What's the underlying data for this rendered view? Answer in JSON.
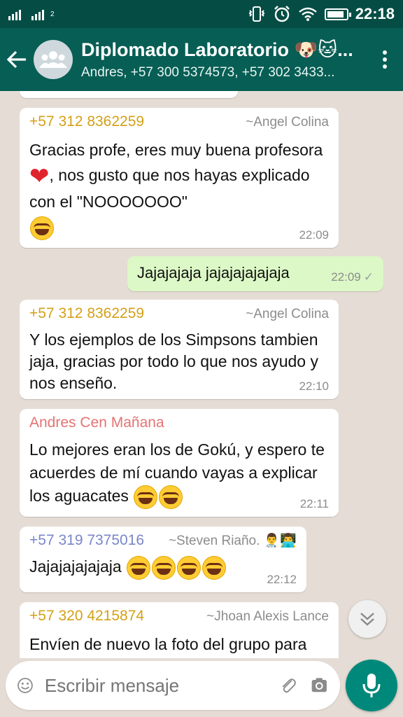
{
  "status_bar": {
    "signal1_label": "",
    "signal2_label": "2",
    "time": "22:18",
    "battery_level": 0.9
  },
  "header": {
    "title": "Diplomado Laboratorio 🐶🐱...",
    "subtitle": "Andres, +57 300 5374573, +57 302 3433..."
  },
  "messages": [
    {
      "sender": "+57 312 8362259",
      "sender_color": "#d4a017",
      "pushname": "~Angel Colina",
      "text_a": "Gracias profe, eres muy buena profesora ",
      "text_b": ", nos gusto que nos hayas explicado con el \"NOOOOOOO\"",
      "time": "22:09"
    },
    {
      "text": "Jajajajaja jajajajajajaja",
      "time": "22:09",
      "outgoing": true
    },
    {
      "sender": "+57 312 8362259",
      "sender_color": "#d4a017",
      "pushname": "~Angel Colina",
      "text": "Y los ejemplos de los Simpsons tambien jaja, gracias por todo lo que nos ayudo y nos enseño.",
      "time": "22:10"
    },
    {
      "sender": "Andres Cen Mañana",
      "sender_color": "#e57373",
      "text": "Lo mejores eran los de Gokú, y espero te acuerdes de mí cuando vayas a explicar los aguacates ",
      "time": "22:11"
    },
    {
      "sender": "+57 319 7375016",
      "sender_color": "#7986cb",
      "pushname": "~Steven Riaño. 👨‍⚕️👨‍💻",
      "text": "Jajajajajajaja ",
      "time": "22:12"
    },
    {
      "sender": "+57 320 4215874",
      "sender_color": "#d4a017",
      "pushname": "~Jhoan Alexis Lance",
      "text": "Envíen de nuevo la foto del grupo para"
    }
  ],
  "input": {
    "placeholder": "Escribir mensaje"
  },
  "colors": {
    "header": "#075e54",
    "status_bar": "#054d44",
    "outgoing_bubble": "#dcf8c6",
    "mic_button": "#00897b"
  },
  "icons": [
    "back-arrow-icon",
    "group-avatar-icon",
    "more-vert-icon",
    "chevron-double-down-icon",
    "emoji-icon",
    "attach-icon",
    "camera-icon",
    "mic-icon"
  ]
}
